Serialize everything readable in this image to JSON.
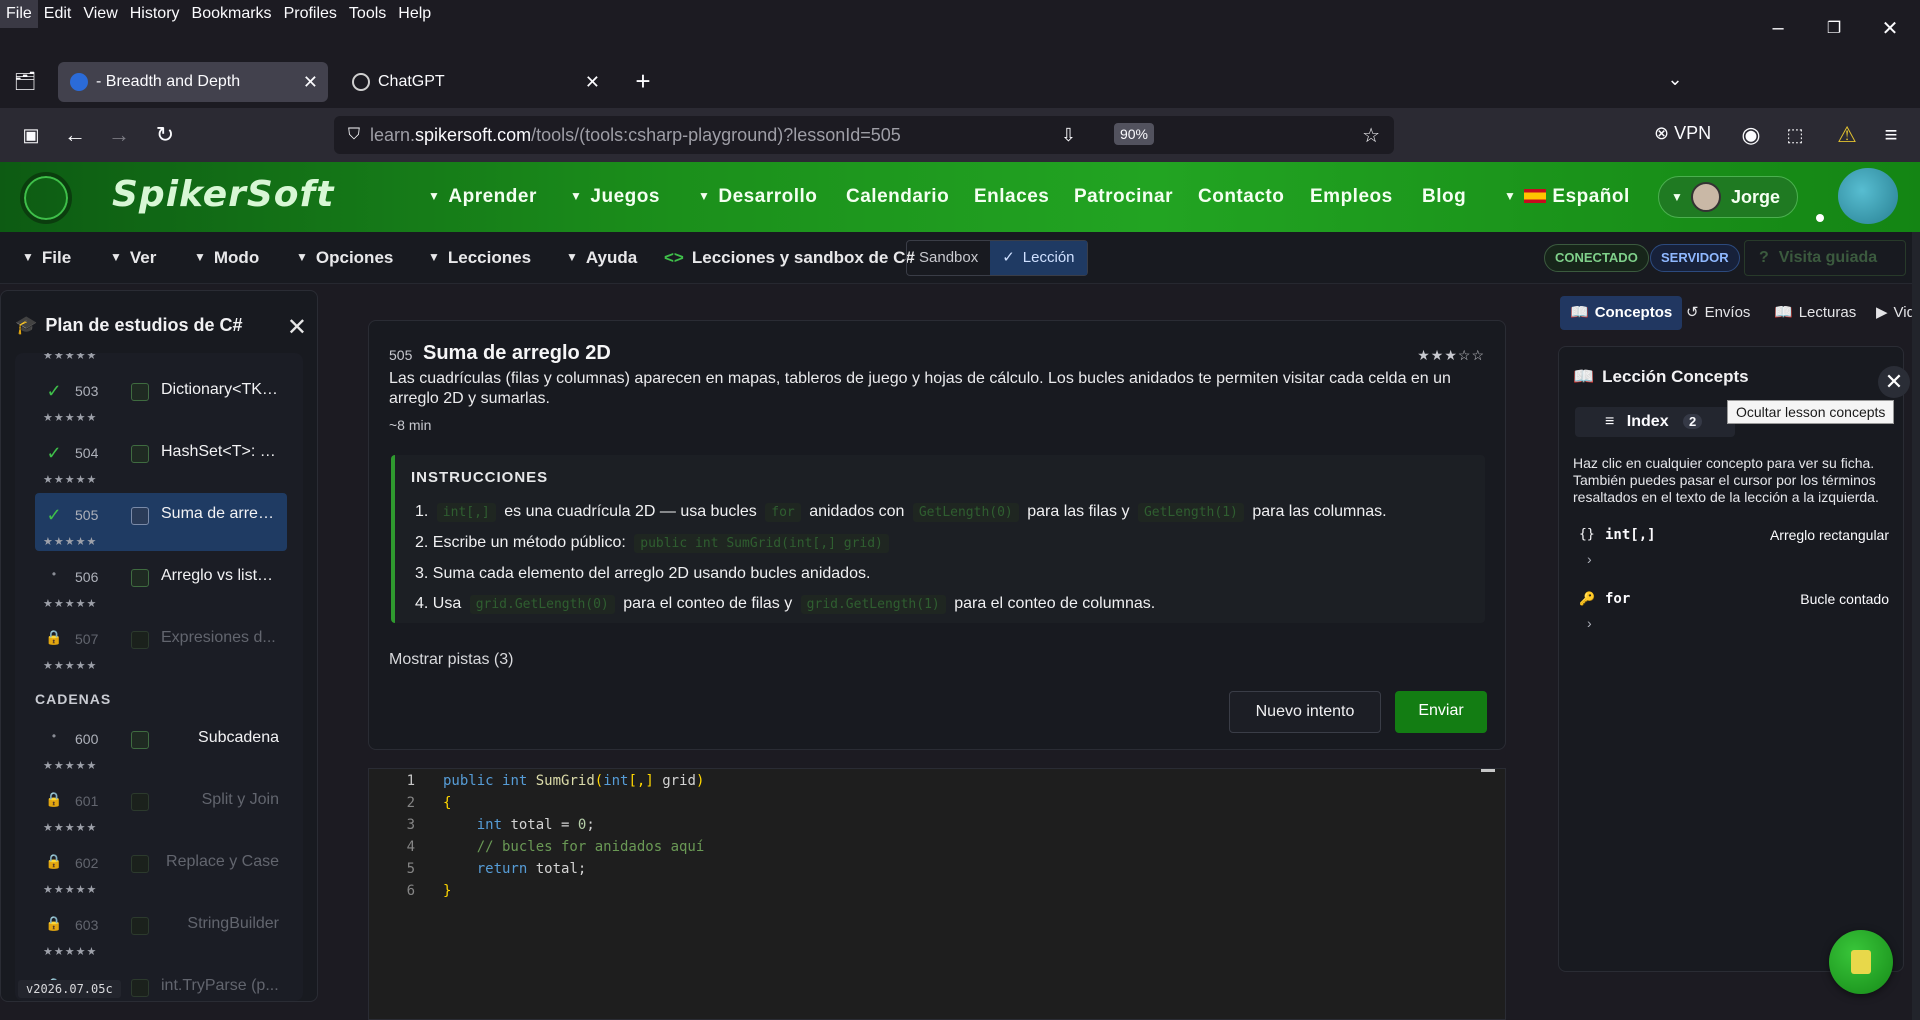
{
  "menubar": {
    "items": [
      "File",
      "Edit",
      "View",
      "History",
      "Bookmarks",
      "Profiles",
      "Tools",
      "Help"
    ]
  },
  "tabs": [
    {
      "title": "- Breadth and Depth",
      "active": true
    },
    {
      "title": "ChatGPT",
      "active": false
    }
  ],
  "url": {
    "prefix": "learn.",
    "domain": "spikersoft.com",
    "path": "/tools/(tools:csharp-playground)?lessonId=505"
  },
  "zoom": "90%",
  "vpn_label": "VPN",
  "site": {
    "logo": "SpikerSoft",
    "nav": [
      "Aprender",
      "Juegos",
      "Desarrollo",
      "Calendario",
      "Enlaces",
      "Patrocinar",
      "Contacto",
      "Empleos",
      "Blog"
    ],
    "language": "Español",
    "user": "Jorge"
  },
  "toolbar": {
    "menus": [
      "File",
      "Ver",
      "Modo",
      "Opciones",
      "Lecciones",
      "Ayuda"
    ],
    "breadcrumb": "Lecciones y sandbox de C#",
    "mode_sandbox": "Sandbox",
    "mode_lesson": "Lección",
    "status_connected": "CONECTADO",
    "status_server": "SERVIDOR",
    "guided_tour": "Visita guiada"
  },
  "sidebar": {
    "title": "Plan de estudios de C#",
    "stars": "★★★★★",
    "lessons": [
      {
        "num": "503",
        "label": "Dictionary<TK,...",
        "status": "done"
      },
      {
        "num": "504",
        "label": "HashSet<T>: d...",
        "status": "done"
      },
      {
        "num": "505",
        "label": "Suma de arreg...",
        "status": "done"
      },
      {
        "num": "506",
        "label": "Arreglo vs lista...",
        "status": "open"
      },
      {
        "num": "507",
        "label": "Expresiones d...",
        "status": "locked"
      }
    ],
    "section": "CADENAS",
    "lessons2": [
      {
        "num": "600",
        "label": "Subcadena",
        "status": "open"
      },
      {
        "num": "601",
        "label": "Split y Join",
        "status": "locked"
      },
      {
        "num": "602",
        "label": "Replace y Case",
        "status": "locked"
      },
      {
        "num": "603",
        "label": "StringBuilder",
        "status": "locked"
      },
      {
        "num": "604",
        "label": "int.TryParse (p...",
        "status": "locked"
      }
    ],
    "version": "v2026.07.05c"
  },
  "lesson": {
    "number": "505",
    "title": "Suma de arreglo 2D",
    "rating": "★★★☆☆",
    "description": "Las cuadrículas (filas y columnas) aparecen en mapas, tableros de juego y hojas de cálculo. Los bucles anidados te permiten visitar cada celda en un arreglo 2D y sumarlas.",
    "duration": "~8 min",
    "instructions_title": "INSTRUCCIONES",
    "steps": {
      "s1": {
        "n": "1.",
        "c1": "int[,]",
        "t1": "es una cuadrícula 2D — usa bucles",
        "c2": "for",
        "t2": "anidados con",
        "c3": "GetLength(0)",
        "t3": "para las filas y",
        "c4": "GetLength(1)",
        "t4": "para las columnas."
      },
      "s2": {
        "n": "2.",
        "t1": "Escribe un método público:",
        "c1": "public int SumGrid(int[,] grid)"
      },
      "s3": {
        "n": "3.",
        "t1": "Suma cada elemento del arreglo 2D usando bucles anidados."
      },
      "s4": {
        "n": "4.",
        "t1": "Usa",
        "c1": "grid.GetLength(0)",
        "t2": "para el conteo de filas y",
        "c2": "grid.GetLength(1)",
        "t3": "para el conteo de columnas."
      }
    },
    "hints": "Mostrar pistas (3)",
    "reset_label": "Nuevo intento",
    "submit_label": "Enviar"
  },
  "editor": {
    "line_numbers": [
      "1",
      "2",
      "3",
      "4",
      "5",
      "6"
    ]
  },
  "right": {
    "tabs": [
      "Conceptos",
      "Envíos",
      "Lecturas",
      "Vid"
    ],
    "title": "Lección Concepts",
    "index_label": "Index",
    "index_count": "2",
    "hint": "Haz clic en cualquier concepto para ver su ficha. También puedes pasar el cursor por los términos resaltados en el texto de la lección a la izquierda.",
    "concepts": [
      {
        "icon": "{}",
        "term": "int[,]",
        "desc": "Arreglo rectangular"
      },
      {
        "icon": "🔑",
        "term": "for",
        "desc": "Bucle contado"
      }
    ],
    "tooltip": "Ocultar lesson concepts"
  },
  "colors": {
    "brand_green": "#1b8f1b",
    "selected": "#1f3b63",
    "submit": "#137d13"
  }
}
